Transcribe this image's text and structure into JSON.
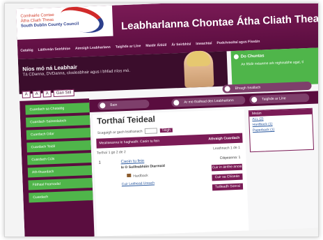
{
  "logo": {
    "line1": "Comhairle Contae",
    "line2": "Átha Cliath Theas",
    "line3": "South Dublin County Council"
  },
  "header": {
    "title": "Leabharlanna Chontae Átha Cliath Theas"
  },
  "topnav": [
    "Catalóg",
    "Láithreán Seirbhíse",
    "Aimsigh Leabharlann",
    "Taighde ar Líne",
    "Maidir Áitiúil",
    "Ár Seirbhísí",
    "Imeachtaí",
    "Podchraoltaí agus Físeáin"
  ],
  "welcome": {
    "heading": "Níos mó ná Leabhair",
    "text": "Tá CDanna, DVDanna, closleabhair agus i bhfad níos mó."
  },
  "promo": {
    "title": "Do Chuntas",
    "text": "An féidir méanme ark nighinabhe agat, tí"
  },
  "textsize": [
    "A",
    "A",
    "A",
    "Gan Stíl"
  ],
  "pillbar": {
    "search": "Bain",
    "online": "Ar mo thaifead den Leabharlann",
    "research": "Taighde ar Líne",
    "change": "Bhragh Seallach"
  },
  "sidebar": [
    "Cuardach sa Chatalóg",
    "Cuardach Saineolaíoch",
    "Cuardach Údar",
    "Cuardach Teidil",
    "Cuardach Cúls",
    "Ath-thuardach",
    "Fáthasl Feamadaí",
    "Cuardach"
  ],
  "main": {
    "title": "Torthaí Teideal",
    "filter_label": "Scagaigh ar gach leathanach",
    "filter_button": "Téigh",
    "results_header": "Meaitseanna le haghaidh: Caoin tu fein",
    "refine": "Athraigh Cuardach",
    "count": "Torthaí 1 go 2 de 2",
    "page": "Leathnach 1 de 1"
  },
  "result": {
    "number": "1",
    "title": "Caoin tu fein",
    "author": "le O Suilleabháin Diarmaid",
    "format": "Hardback",
    "more": "Cuir Leithead Ureach",
    "copies": "Cóipeanna: 1",
    "action1": "Cuir in áirithe anois",
    "action2": "Cuir sa Chiseán",
    "action3": "Tuilleadh Sonraí"
  },
  "facets": {
    "title": "Meáin",
    "items": [
      "ALL (2)",
      "Hardback (1)",
      "Paperback (1)"
    ]
  },
  "colors": {
    "brand_purple": "#7b1b56",
    "dark_purple": "#5a0d3f",
    "accent_green": "#4fb54a",
    "link_blue": "#2c5aa0"
  }
}
